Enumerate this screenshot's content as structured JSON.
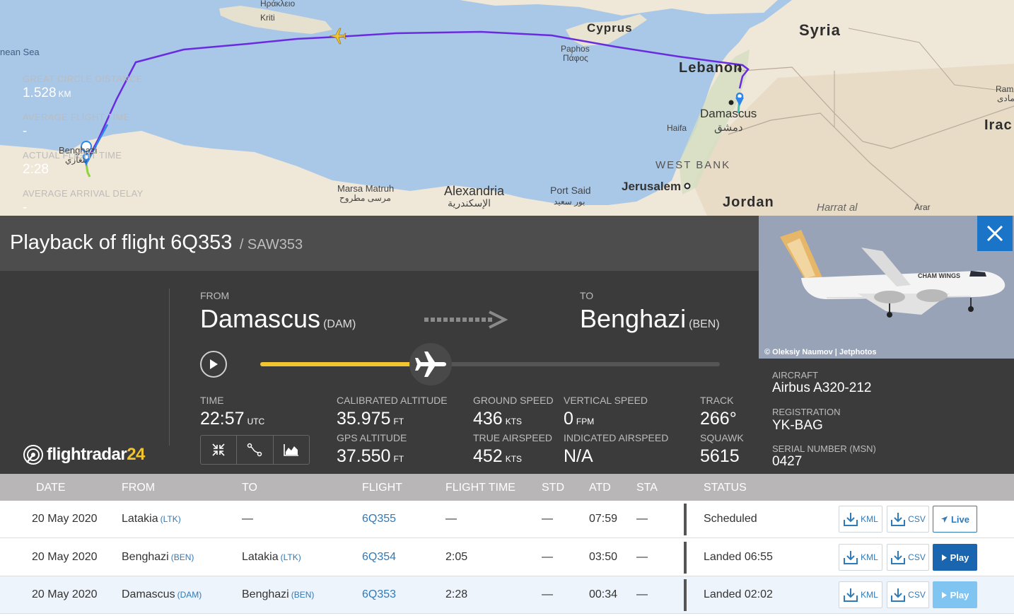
{
  "map": {
    "labels": {
      "heraklion": "Ηράκλειο",
      "kriti": "Kriti",
      "sea": "nean Sea",
      "cyprus": "Cyprus",
      "paphos": "Paphos",
      "paphos_gr": "Πάφος",
      "syria": "Syria",
      "lebanon": "Lebanon",
      "damascus": "Damascus",
      "damascus_ar": "دمشق",
      "haifa": "Haifa",
      "westbank": "WEST BANK",
      "jerusalem": "Jerusalem",
      "jordan": "Jordan",
      "harrat": "Harrat al",
      "arar": "Arar",
      "iraq": "Irac",
      "ram": "Ram",
      "ram_ar": "رمادی",
      "benghazi": "Benghazi",
      "benghazi_ar": "بنغازي",
      "marsa": "Marsa Matruh",
      "marsa_ar": "مرسى مطروح",
      "alexandria": "Alexandria",
      "alexandria_ar": "الإسكندرية",
      "portsaid": "Port Said",
      "portsaid_ar": "بور سعيد"
    }
  },
  "panel": {
    "title": "Playback of flight 6Q353",
    "callsign": "/ SAW353",
    "stats": [
      {
        "label": "GREAT CIRCLE DISTANCE",
        "value": "1.528",
        "unit": "KM"
      },
      {
        "label": "AVERAGE FLIGHT TIME",
        "value": "-",
        "unit": ""
      },
      {
        "label": "ACTUAL FLIGHT TIME",
        "value": "2:28",
        "unit": ""
      },
      {
        "label": "AVERAGE ARRIVAL DELAY",
        "value": "-",
        "unit": ""
      }
    ],
    "brand": {
      "main": "flightradar",
      "num": "24"
    },
    "from": {
      "label": "FROM",
      "city": "Damascus",
      "code": "(DAM)"
    },
    "to": {
      "label": "TO",
      "city": "Benghazi",
      "code": "(BEN)"
    },
    "progress": 0.37,
    "time": {
      "label": "TIME",
      "value": "22:57",
      "unit": "UTC"
    },
    "cal_alt": {
      "label": "CALIBRATED ALTITUDE",
      "value": "35.975",
      "unit": "FT"
    },
    "gps_alt": {
      "label": "GPS ALTITUDE",
      "value": "37.550",
      "unit": "FT"
    },
    "ground_speed": {
      "label": "GROUND SPEED",
      "value": "436",
      "unit": "KTS"
    },
    "true_airspeed": {
      "label": "TRUE AIRSPEED",
      "value": "452",
      "unit": "KTS"
    },
    "vertical_speed": {
      "label": "VERTICAL SPEED",
      "value": "0",
      "unit": "FPM"
    },
    "indicated_airspeed": {
      "label": "INDICATED AIRSPEED",
      "value": "N/A"
    },
    "track": {
      "label": "TRACK",
      "value": "266°"
    },
    "squawk": {
      "label": "SQUAWK",
      "value": "5615"
    }
  },
  "aircraft": {
    "photo_credit": "© Oleksiy Naumov | Jetphotos",
    "livery_text": "CHAM WINGS",
    "aircraft_label": "AIRCRAFT",
    "aircraft_value": "Airbus A320-212",
    "registration_label": "REGISTRATION",
    "registration_value": "YK-BAG",
    "serial_label": "SERIAL NUMBER (MSN)",
    "serial_value": "0427"
  },
  "table": {
    "headers": {
      "date": "DATE",
      "from": "FROM",
      "to": "TO",
      "flight": "FLIGHT",
      "flight_time": "FLIGHT TIME",
      "std": "STD",
      "atd": "ATD",
      "sta": "STA",
      "status": "STATUS"
    },
    "kml": "KML",
    "csv": "CSV",
    "rows": [
      {
        "date": "20 May 2020",
        "from": "Latakia",
        "from_code": "(LTK)",
        "to": "—",
        "to_code": "",
        "flight": "6Q355",
        "flight_time": "—",
        "std": "—",
        "atd": "07:59",
        "sta": "—",
        "status": "Scheduled",
        "action": "Live"
      },
      {
        "date": "20 May 2020",
        "from": "Benghazi",
        "from_code": "(BEN)",
        "to": "Latakia",
        "to_code": "(LTK)",
        "flight": "6Q354",
        "flight_time": "2:05",
        "std": "—",
        "atd": "03:50",
        "sta": "—",
        "status": "Landed 06:55",
        "action": "Play"
      },
      {
        "date": "20 May 2020",
        "from": "Damascus",
        "from_code": "(DAM)",
        "to": "Benghazi",
        "to_code": "(BEN)",
        "flight": "6Q353",
        "flight_time": "2:28",
        "std": "—",
        "atd": "00:34",
        "sta": "—",
        "status": "Landed 02:02",
        "action": "Play"
      }
    ]
  },
  "colors": {
    "accent_yellow": "#f2c430",
    "link_blue": "#2f7ab8",
    "play_blue": "#1a65b0",
    "play_light": "#80c4f2",
    "close_blue": "#1a75c9",
    "route_purple": "#6a2be0"
  }
}
